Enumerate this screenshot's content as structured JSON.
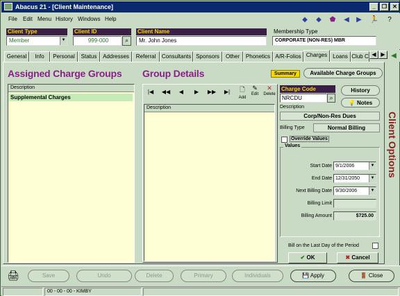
{
  "window": {
    "title": "Abacus 21 - [Client Maintenance]"
  },
  "menu": [
    "File",
    "Edit",
    "Menu",
    "History",
    "Windows",
    "Help"
  ],
  "header": {
    "client_type": {
      "label": "Client Type",
      "value": "Member"
    },
    "client_id": {
      "label": "Client ID",
      "value": "999-000"
    },
    "client_name": {
      "label": "Client Name",
      "value": "Mr. John  Jones"
    },
    "membership_type": {
      "label": "Membership Type",
      "value": "CORPORATE (NON-RES) MBR"
    }
  },
  "tabs": [
    "General",
    "Info",
    "Personal",
    "Status",
    "Addresses",
    "Referral",
    "Consultants",
    "Sponsors",
    "Other",
    "Phonetics",
    "A/R-Folios",
    "Charges",
    "Loans",
    "Club C"
  ],
  "active_tab": "Charges",
  "assigned": {
    "title": "Assigned Charge Groups",
    "col": "Description",
    "rows": [
      "Supplemental Charges"
    ]
  },
  "details": {
    "title": "Group Details",
    "col": "Description",
    "nav": [
      "|◀",
      "◀◀",
      "◀",
      "▶",
      "▶▶",
      "▶|"
    ],
    "add": "Add",
    "edit": "Edit",
    "delete": "Delete"
  },
  "summary_btn": "Summary",
  "available_btn": "Available Charge Groups",
  "charge": {
    "code_label": "Charge Code",
    "code": "NRCDU",
    "history": "History",
    "notes": "Notes",
    "desc_label": "Description",
    "desc": "Corp/Non-Res Dues",
    "billing_type_label": "Billing Type",
    "billing_type": "Normal Billing",
    "override": "Override Values",
    "values_label": "Values",
    "start_label": "Start Date",
    "start": "9/1/2006",
    "end_label": "End Date",
    "end": "12/31/2050",
    "next_label": "Next Billing Date",
    "next": "9/30/2006",
    "limit_label": "Billing Limit",
    "limit": "",
    "amount_label": "Billing Amount",
    "amount": "$725.00",
    "last_day": "Bill on the Last Day of the Period",
    "ok": "OK",
    "cancel": "Cancel"
  },
  "side_label": "Client Options",
  "bottom": {
    "save": "Save",
    "undo": "Undo",
    "delete": "Delete",
    "primary": "Primary",
    "individuals": "Individuals",
    "apply": "Apply",
    "close": "Close"
  },
  "status": {
    "text": "00 - 00 - 00 - KIMBY"
  }
}
